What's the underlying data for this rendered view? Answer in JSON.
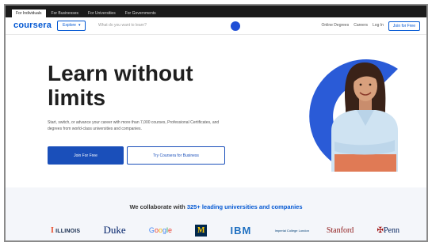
{
  "topbar": {
    "tabs": [
      "For Individuals",
      "For Businesses",
      "For Universities",
      "For Governments"
    ]
  },
  "nav": {
    "logo": "coursera",
    "explore_label": "Explore",
    "search_placeholder": "What do you want to learn?",
    "links": [
      "Online Degrees",
      "Careers",
      "Log In"
    ],
    "join_label": "Join for Free"
  },
  "hero": {
    "title_line1": "Learn without",
    "title_line2": "limits",
    "subtitle": "Start, switch, or advance your career with more than 7,000 courses, Professional Certificates, and degrees from world-class universities and companies.",
    "primary_cta": "Join For Free",
    "secondary_cta": "Try Coursera for Business"
  },
  "partners": {
    "heading_prefix": "We collaborate with",
    "heading_accent": "325+ leading universities and companies",
    "logos": {
      "illinois": "ILLINOIS",
      "duke": "Duke",
      "google": "Google",
      "michigan": "M",
      "ibm": "IBM",
      "imperial": "Imperial College London",
      "stanford": "Stanford",
      "penn": "Penn"
    }
  },
  "colors": {
    "brand_blue": "#0056d2",
    "cta_blue": "#1a4fba",
    "hero_c": "#2a5bd7",
    "topbar": "#1b1b1b",
    "partners_bg": "#f4f6fa"
  }
}
